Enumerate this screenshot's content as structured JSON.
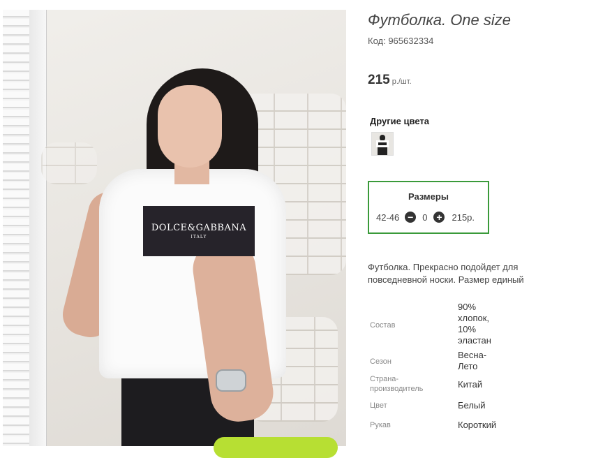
{
  "product": {
    "title": "Футболка. One size",
    "code": "Код: 965632334",
    "price_value": "215",
    "price_unit": "р./шт.",
    "image_print_brand": "DOLCE&GABBANA",
    "image_print_sub": "ITALY"
  },
  "other_colors": {
    "heading": "Другие цвета"
  },
  "sizes": {
    "heading": "Размеры",
    "row": {
      "size": "42-46",
      "minus_icon": "minus-circle-icon",
      "qty": "0",
      "plus_icon": "plus-circle-icon",
      "price": "215р."
    }
  },
  "description": "Футболка. Прекрасно подойдет для повседневной носки. Размер единый",
  "specs": [
    {
      "key": "Состав",
      "value": "90% хлопок, 10% эластан"
    },
    {
      "key": "Сезон",
      "value": "Весна-Лето"
    },
    {
      "key": "Страна-производитель",
      "value": "Китай"
    },
    {
      "key": "Цвет",
      "value": "Белый"
    },
    {
      "key": "Рукав",
      "value": "Короткий"
    }
  ],
  "colors": {
    "sizes_border": "#3a9a3a",
    "cart_button": "#b7df33"
  }
}
